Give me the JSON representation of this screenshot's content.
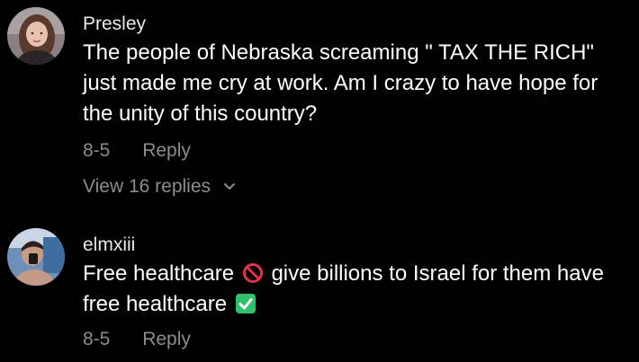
{
  "comments": [
    {
      "username": "Presley",
      "text": "The people of Nebraska screaming \" TAX THE RICH\" just made me cry at work. Am I crazy to have hope for the unity of this country?",
      "date": "8-5",
      "reply_label": "Reply",
      "view_replies": "View 16 replies"
    },
    {
      "username": "elmxiii",
      "text_part1": "Free healthcare",
      "text_part2": "give billions to Israel for them have free healthcare",
      "emoji1": "no-entry-sign-icon",
      "emoji2": "check-mark-button-icon",
      "date": "8-5",
      "reply_label": "Reply"
    }
  ],
  "colors": {
    "background": "#000000",
    "text": "#ffffff",
    "secondary": "#8c8c8c",
    "no_entry": "#e5324a",
    "check": "#2fc26b"
  }
}
